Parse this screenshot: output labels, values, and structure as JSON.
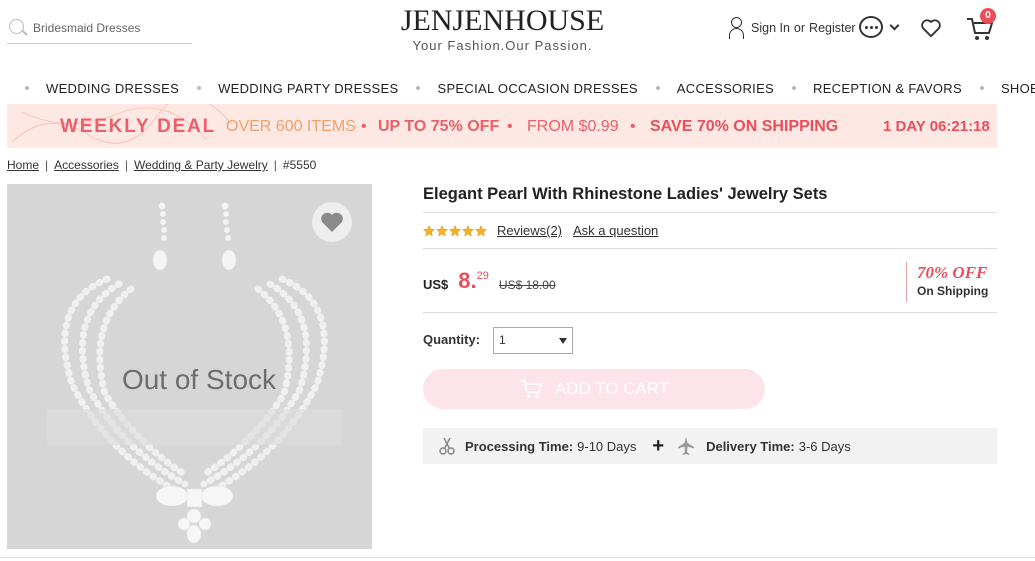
{
  "header": {
    "search_placeholder": "Bridesmaid Dresses",
    "logo_name": "JENJENHOUSE",
    "logo_tagline": "Your Fashion.Our Passion.",
    "sign_in": "Sign In",
    "or": "or",
    "register": "Register",
    "cart_count": "0"
  },
  "nav": {
    "items": [
      "WEDDING DRESSES",
      "WEDDING PARTY DRESSES",
      "SPECIAL OCCASION DRESSES",
      "ACCESSORIES",
      "RECEPTION & FAVORS",
      "SHOES"
    ]
  },
  "deal": {
    "title": "WEEKLY DEAL",
    "items_count": "OVER 600 ITEMS",
    "up_to": "UP TO 75% OFF",
    "from": "FROM $0.99",
    "shipping": "SAVE 70% ON SHIPPING",
    "bullet": "•",
    "timer": "1 DAY 06:21:18"
  },
  "breadcrumb": {
    "items": [
      "Home",
      "Accessories",
      "Wedding & Party Jewelry"
    ],
    "sep": "|",
    "sku": "#5550"
  },
  "product": {
    "image_overlay": "Out of Stock",
    "title": "Elegant Pearl With Rhinestone Ladies' Jewelry Sets",
    "rating_stars": 5,
    "reviews": "Reviews(2)",
    "ask": "Ask a question",
    "currency": "US$",
    "price_int": "8.",
    "price_dec": "29",
    "old_price": "US$ 18.00",
    "ship_off": "70% OFF",
    "ship_sub": "On Shipping",
    "qty_label": "Quantity:",
    "qty_value": "1",
    "add_to_cart": "ADD TO CART",
    "processing_label": "Processing Time:",
    "processing_value": "9-10 Days",
    "plus": "+",
    "delivery_label": "Delivery Time:",
    "delivery_value": "3-6 Days"
  },
  "colors": {
    "accent": "#e94e5b",
    "deal_bg": "#fde8e3",
    "cart_button_bg": "#fde4ea"
  }
}
